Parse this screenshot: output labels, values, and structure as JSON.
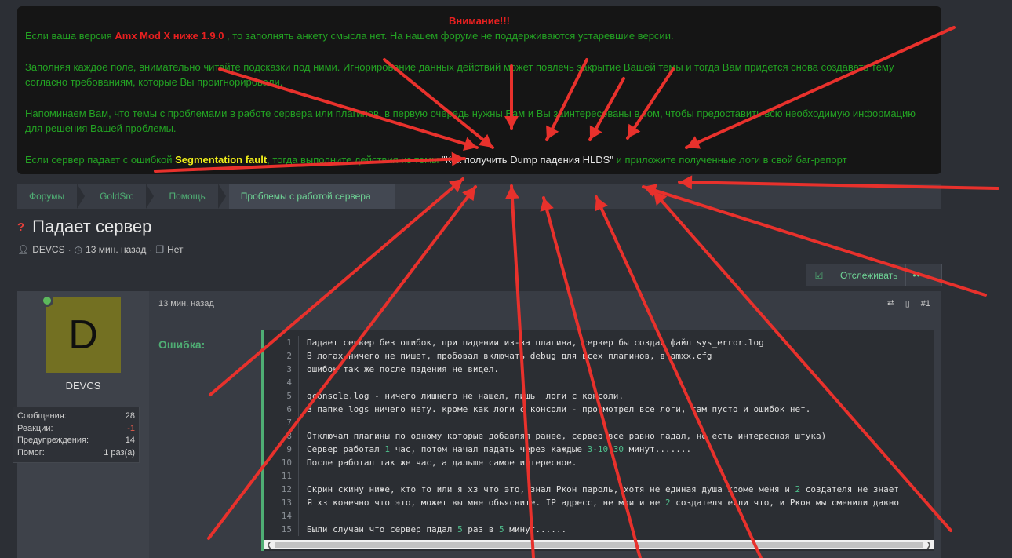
{
  "notice": {
    "title": "Внимание!!!",
    "p1_a": "Если ваша версия ",
    "p1_version": "Amx Mod X ниже 1.9.0",
    "p1_b": " , то заполнять анкету смысла нет. На нашем форуме не поддерживаются устаревшие версии.",
    "p2": "Заполняя каждое поле, внимательно читайте подсказки под ними. Игнорирование данных действий может повлечь закрытие Вашей темы и тогда Вам придется снова создавать тему согласно требованиям, которые Вы проигнорировали.",
    "p3": "Напоминаем Вам, что темы с проблемами в работе сервера или плагинов, в первую очередь нужны Вам и Вы заинтересованы в том, чтобы предоставить всю необходимую информацию для решения Вашей проблемы.",
    "p4_a": "Если сервер падает с ошибкой ",
    "p4_error": "Segmentation fault",
    "p4_b": ", тогда выполните действия из темы ",
    "p4_link": "\"Как получить Dump падения HLDS\"",
    "p4_c": " и приложите полученные логи в свой баг-репорт"
  },
  "breadcrumbs": [
    "Форумы",
    "GoldSrc",
    "Помощь",
    "Проблемы с работой сервера"
  ],
  "thread": {
    "title": "Падает сервер",
    "author": "DEVCS",
    "time": "13 мин. назад",
    "tags": "Нет"
  },
  "watch": {
    "label": "Отслеживать",
    "more": "•••"
  },
  "post": {
    "avatar_letter": "D",
    "username": "DEVCS",
    "stats": [
      {
        "label": "Сообщения:",
        "value": "28"
      },
      {
        "label": "Реакции:",
        "value": "-1"
      },
      {
        "label": "Предупреждения:",
        "value": "14"
      },
      {
        "label": "Помог:",
        "value": "1 раз(а)"
      }
    ],
    "time": "13 мин. назад",
    "number": "#1",
    "field_label": "Ошибка:",
    "code_lines": [
      {
        "n": "1",
        "t": "Падает сервер без ошибок, при падении из-за плагина, сервер бы создал файл sys_error.log"
      },
      {
        "n": "2",
        "t": "В логах ничего не пишет, пробовал включать debug для всех плагинов, в amxx.cfg"
      },
      {
        "n": "3",
        "t": "ошибок так же после падения не видел."
      },
      {
        "n": "4",
        "t": ""
      },
      {
        "n": "5",
        "t": "qconsole.log - ничего лишнего не нашел, лишь  логи с консоли."
      },
      {
        "n": "6",
        "t": "В папке logs ничего нету. кроме как логи с консоли - просмотрел все логи, там пусто и ошибок нет."
      },
      {
        "n": "7",
        "t": ""
      },
      {
        "n": "8",
        "t": "Отключал плагины по одному которые добавлял ранее, сервер все равно падал, но есть интересная штука)"
      },
      {
        "n": "9",
        "pre": "Сервер работал ",
        "h1": "1",
        "mid": " час, потом начал падать через каждые ",
        "h2": "3-10-30",
        "post": " минут......."
      },
      {
        "n": "10",
        "t": "После работал так же час, а дальше самое интересное."
      },
      {
        "n": "11",
        "t": ""
      },
      {
        "n": "12",
        "pre": "Скрин скину ниже, кто то или я хз что это, знал Ркон пароль, хотя не единая душа кроме меня и ",
        "h1": "2",
        "post": " создателя не знает"
      },
      {
        "n": "13",
        "pre": "Я хз конечно что это, может вы мне обьясните. IP адресс, не мои и не ",
        "h1": "2",
        "post": " создателя если что, и Ркон мы сменили давно"
      },
      {
        "n": "14",
        "t": ""
      },
      {
        "n": "15",
        "pre": "Были случаи что сервер падал ",
        "h1": "5",
        "mid": " раз в ",
        "h2": "5",
        "post": " минут......"
      }
    ]
  },
  "arrow_color": "#e8312c"
}
